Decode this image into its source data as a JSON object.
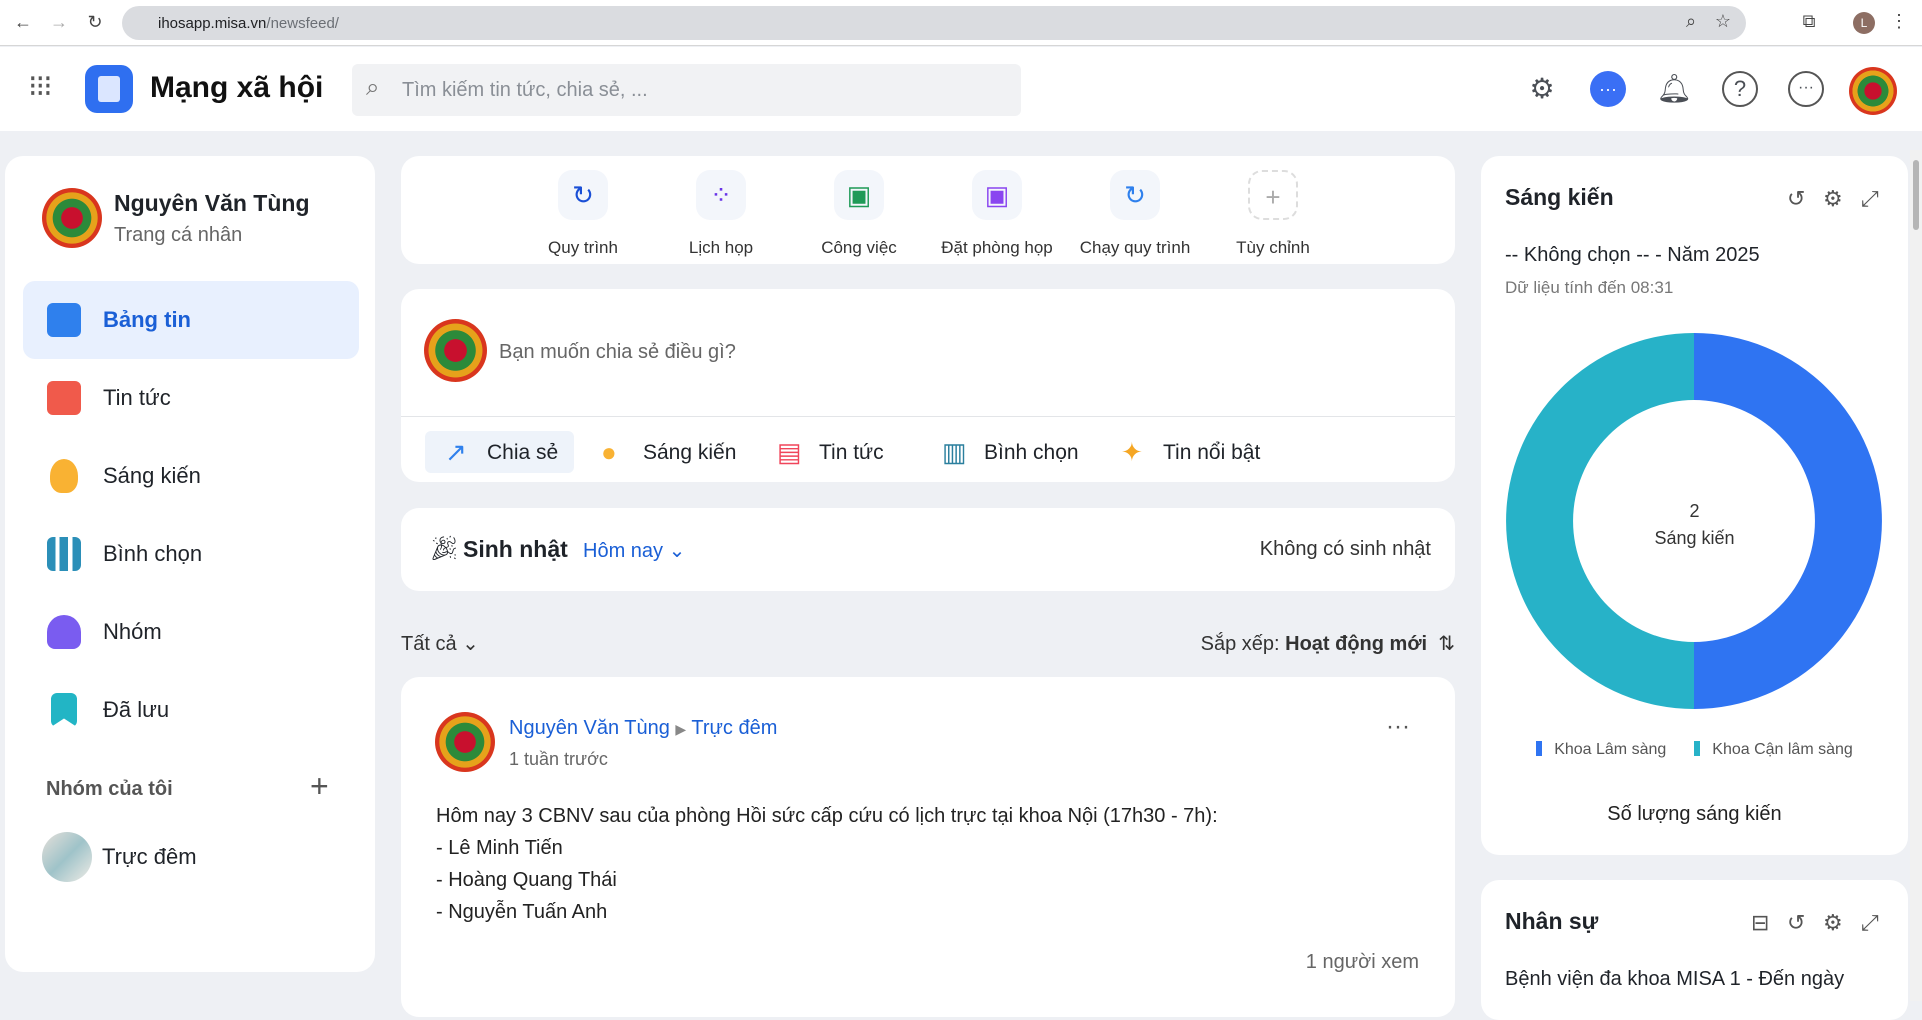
{
  "browser": {
    "url_host": "ihosapp.misa.vn",
    "url_path": "/newsfeed/",
    "profile_initial": "L"
  },
  "header": {
    "title": "Mạng xã hội",
    "search_placeholder": "Tìm kiếm tin tức, chia sẻ, ..."
  },
  "profile": {
    "name": "Nguyên Văn Tùng",
    "subtitle": "Trang cá nhân"
  },
  "sidebar": {
    "items": [
      {
        "label": "Bảng tin",
        "color": "#2f80ed"
      },
      {
        "label": "Tin tức",
        "color": "#f05a4b"
      },
      {
        "label": "Sáng kiến",
        "color": "#f9b233"
      },
      {
        "label": "Bình chọn",
        "color": "#2b8fb8"
      },
      {
        "label": "Nhóm",
        "color": "#7a5cf0"
      },
      {
        "label": "Đã lưu",
        "color": "#22b5c5"
      }
    ],
    "groups_title": "Nhóm của tôi",
    "groups": [
      {
        "label": "Trực đêm"
      }
    ]
  },
  "shortcuts": [
    {
      "label": "Quy trình",
      "icon": "↻",
      "color": "#1a4fd6"
    },
    {
      "label": "Lịch họp",
      "icon": "⁘",
      "color": "#6a35e8"
    },
    {
      "label": "Công việc",
      "icon": "▣",
      "color": "#1f9a57"
    },
    {
      "label": "Đặt phòng họp",
      "icon": "▣",
      "color": "#8a45f0"
    },
    {
      "label": "Chạy quy trình",
      "icon": "↻",
      "color": "#2f80ed"
    },
    {
      "label": "Tùy chỉnh",
      "icon": "+",
      "color": "#aaa"
    }
  ],
  "composer": {
    "placeholder": "Bạn muốn chia sẻ điều gì?",
    "actions": [
      {
        "label": "Chia sẻ",
        "icon": "↗",
        "color": "#2f80ed"
      },
      {
        "label": "Sáng kiến",
        "icon": "●",
        "color": "#f9b233"
      },
      {
        "label": "Tin tức",
        "icon": "▤",
        "color": "#f0455a"
      },
      {
        "label": "Bình chọn",
        "icon": "▥",
        "color": "#2b7f9e"
      },
      {
        "label": "Tin nổi bật",
        "icon": "✦",
        "color": "#f5a623"
      }
    ]
  },
  "birthday": {
    "title": "Sinh nhật",
    "filter": "Hôm nay",
    "status": "Không có sinh nhật"
  },
  "feed": {
    "filter": "Tất cả",
    "sort_label": "Sắp xếp:",
    "sort_value": "Hoạt động mới"
  },
  "post": {
    "author": "Nguyên Văn Tùng",
    "group": "Trực đêm",
    "time": "1 tuần trước",
    "lines": [
      "Hôm nay 3 CBNV sau của phòng Hồi sức cấp cứu có lịch trực tại khoa Nội (17h30 - 7h):",
      "- Lê Minh Tiến",
      "- Hoàng Quang Thái",
      "- Nguyễn Tuấn Anh"
    ],
    "views": "1 người xem"
  },
  "widget_sangkien": {
    "title": "Sáng kiến",
    "filter": "-- Không chọn -- - Năm 2025",
    "updated": "Dữ liệu tính đến 08:31",
    "footer": "Số lượng sáng kiến"
  },
  "widget_nhansu": {
    "title": "Nhân sự",
    "subtitle": "Bệnh viện đa khoa MISA 1 - Đến ngày"
  },
  "chart_data": {
    "type": "pie",
    "title": "Số lượng sáng kiến",
    "center_value": "2",
    "center_label": "Sáng kiến",
    "categories": [
      "Khoa Lâm sàng",
      "Khoa Cận lâm sàng"
    ],
    "values": [
      1,
      1
    ],
    "colors": [
      "#2f74f2",
      "#27b2c8"
    ],
    "legend": "bottom"
  }
}
